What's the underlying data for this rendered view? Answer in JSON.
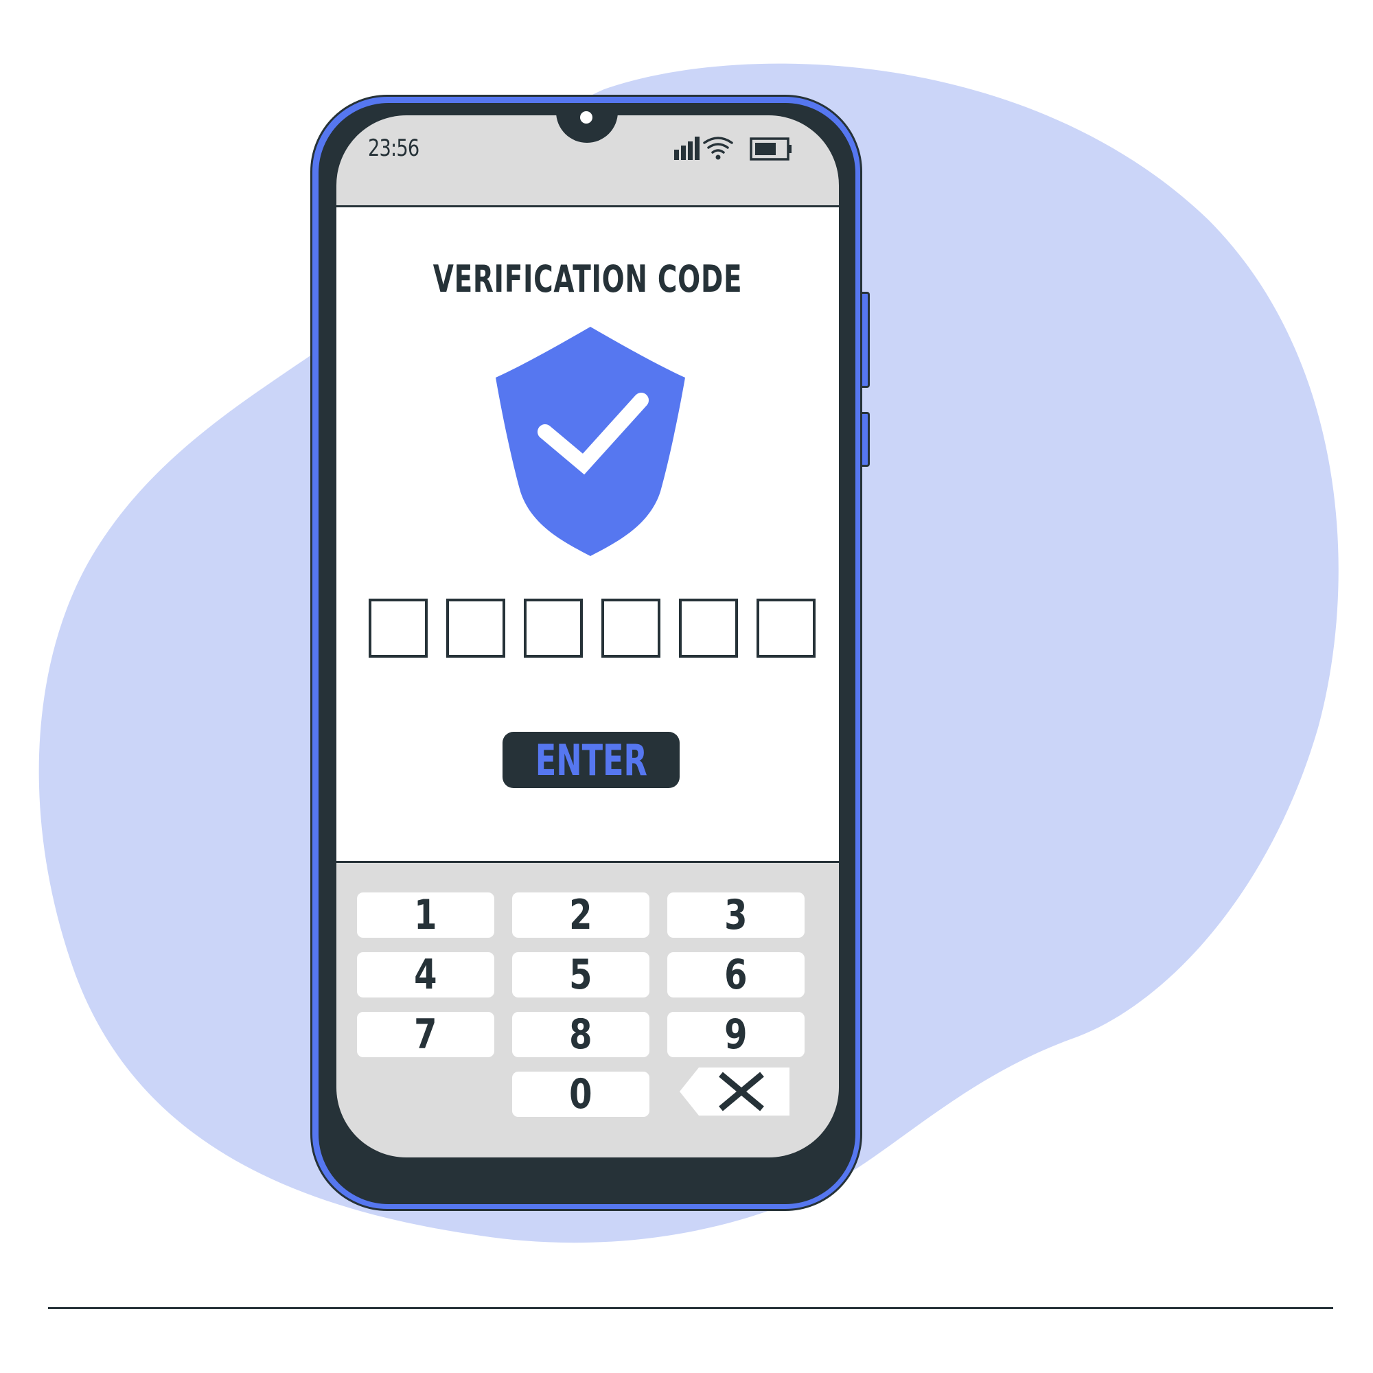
{
  "colors": {
    "accent": "#5677f0",
    "dark": "#263238",
    "blob": "#cbd5f8",
    "screen_gray": "#dcdcdc",
    "white": "#ffffff"
  },
  "status_bar": {
    "time": "23:56",
    "icons": [
      "signal-icon",
      "wifi-icon",
      "battery-icon"
    ]
  },
  "screen": {
    "title": "VERIFICATION CODE",
    "badge_icon": "shield-check-icon",
    "code_boxes": [
      "",
      "",
      "",
      "",
      "",
      ""
    ],
    "enter_label": "ENTER"
  },
  "keypad": {
    "keys": [
      "1",
      "2",
      "3",
      "4",
      "5",
      "6",
      "7",
      "8",
      "9",
      "0"
    ],
    "backspace_icon": "backspace-icon"
  }
}
